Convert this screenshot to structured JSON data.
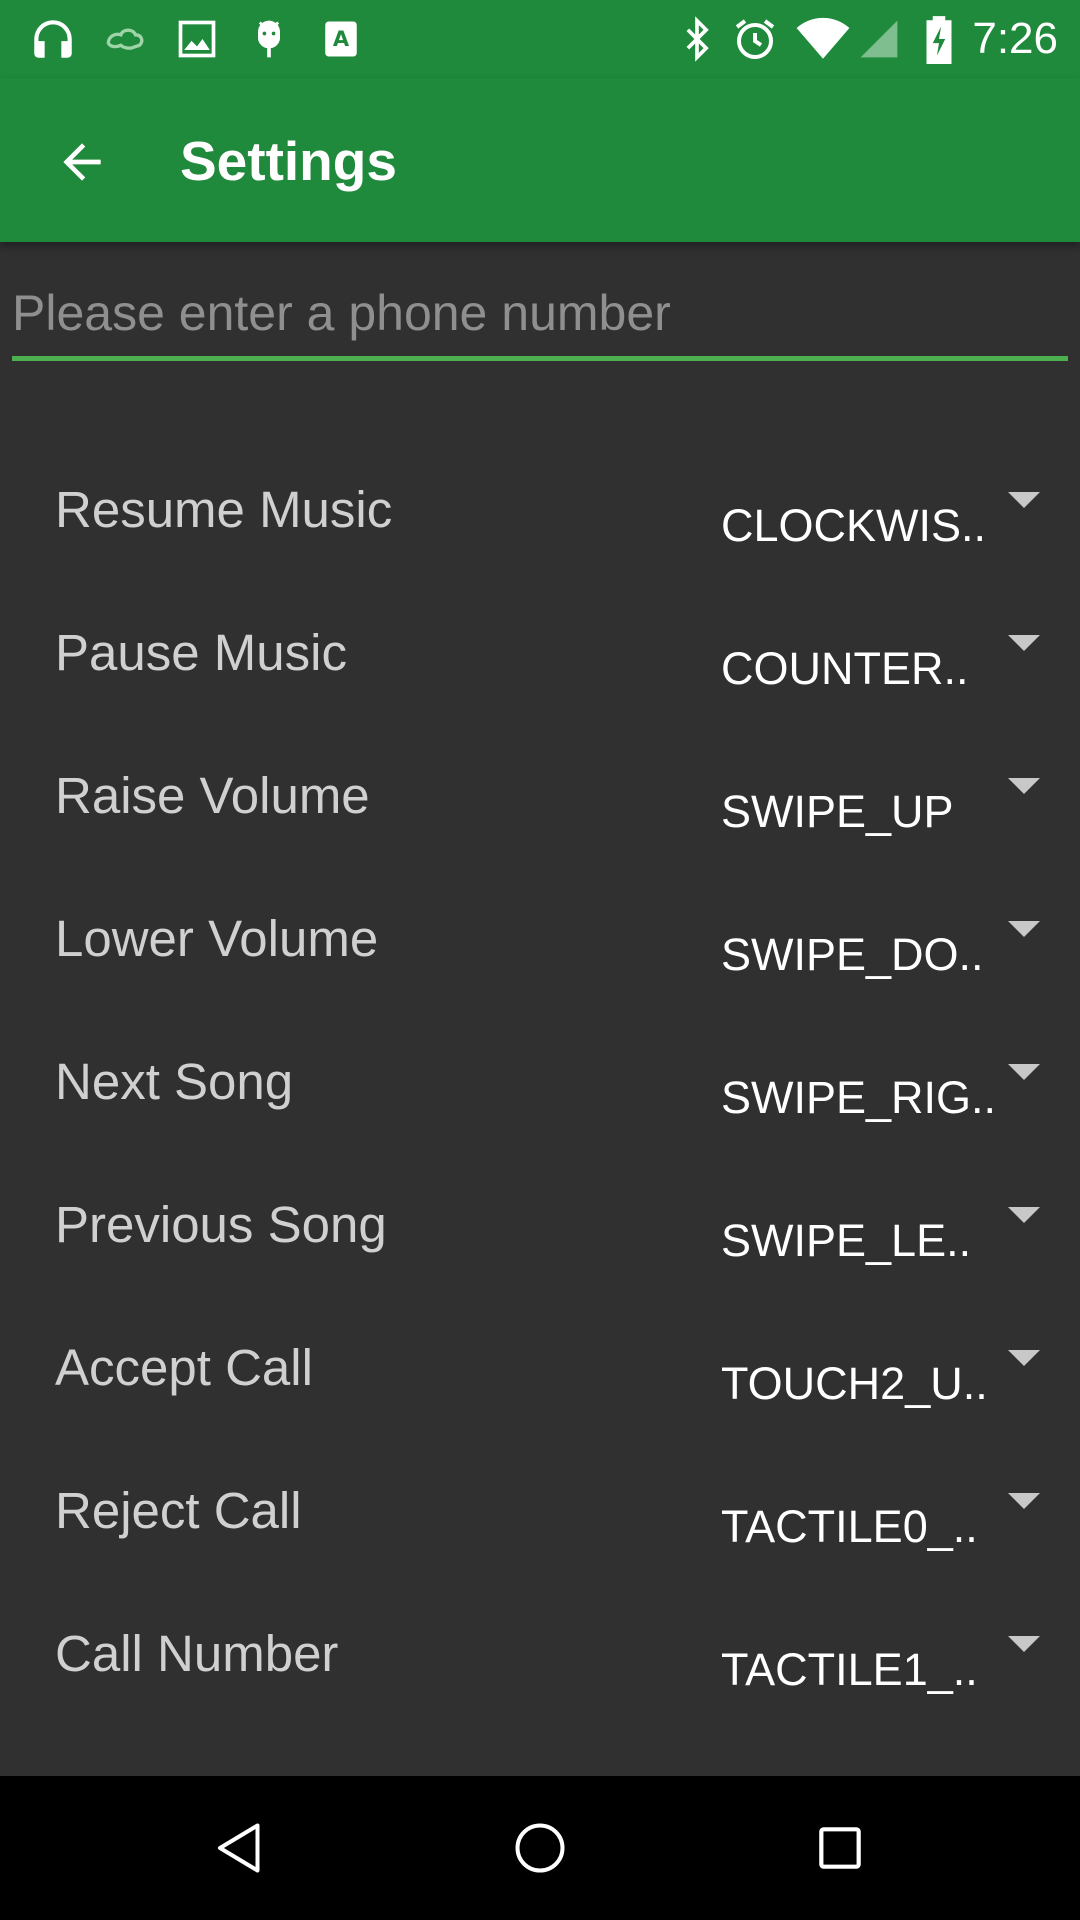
{
  "status_bar": {
    "time": "7:26",
    "left_icons": [
      "headphones-icon",
      "cloud-sync-icon",
      "image-icon",
      "android-icon",
      "keyboard-a-icon"
    ],
    "right_icons": [
      "bluetooth-icon",
      "alarm-icon",
      "wifi-icon",
      "signal-icon",
      "battery-charging-icon"
    ]
  },
  "app_bar": {
    "title": "Settings",
    "color": "#1f8a3b"
  },
  "phone_input": {
    "placeholder": "Please enter a phone number",
    "value": "",
    "underline_color": "#4caf50"
  },
  "settings": [
    {
      "label": "Resume Music",
      "value": "CLOCKWIS.."
    },
    {
      "label": "Pause Music",
      "value": "COUNTER.."
    },
    {
      "label": "Raise Volume",
      "value": "SWIPE_UP"
    },
    {
      "label": "Lower Volume",
      "value": "SWIPE_DO.."
    },
    {
      "label": "Next Song",
      "value": "SWIPE_RIG.."
    },
    {
      "label": "Previous Song",
      "value": "SWIPE_LE.."
    },
    {
      "label": "Accept Call",
      "value": "TOUCH2_U.."
    },
    {
      "label": "Reject Call",
      "value": "TACTILE0_.."
    },
    {
      "label": "Call Number",
      "value": "TACTILE1_.."
    }
  ],
  "nav_bar": {
    "buttons": [
      "back-icon",
      "home-icon",
      "recents-icon"
    ]
  }
}
